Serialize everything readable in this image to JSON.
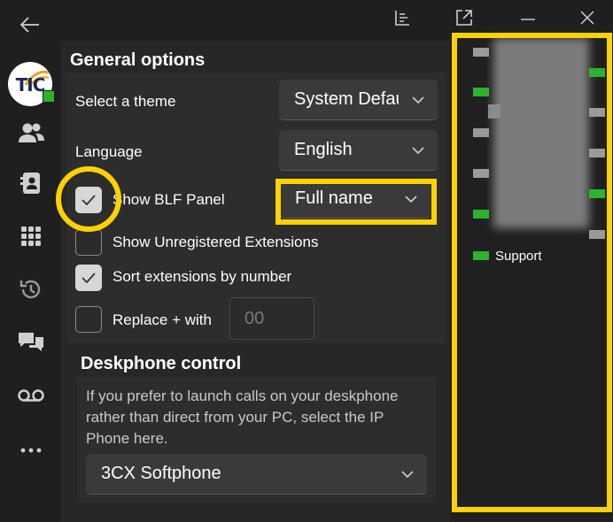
{
  "colors": {
    "accent_yellow": "#ffd200",
    "presence_green": "#2db22d",
    "status_grey": "#9a9a9a",
    "panel_bg": "#2d2d2d"
  },
  "avatar": {
    "text": "TIC"
  },
  "general": {
    "title": "General options",
    "theme": {
      "label": "Select a theme",
      "value": "System Default"
    },
    "language": {
      "label": "Language",
      "value": "English"
    },
    "show_blf": {
      "label": "Show BLF Panel",
      "checked": true,
      "mode": "Full name"
    },
    "unregistered": {
      "label": "Show Unregistered Extensions",
      "checked": false
    },
    "sort_by_number": {
      "label": "Sort extensions by number",
      "checked": true
    },
    "replace_plus": {
      "label": "Replace + with",
      "checked": false,
      "placeholder": "00"
    }
  },
  "deskphone": {
    "title": "Deskphone control",
    "description_line1": "If you prefer to launch calls on your deskphone",
    "description_line2": "rather than direct from your PC, select the IP",
    "description_line3": "Phone here.",
    "device": "3CX Softphone"
  },
  "blf_panel": {
    "visible_label": "Support"
  },
  "icons": {
    "back": "back-arrow-icon",
    "toolbar": [
      "chart-icon",
      "popout-icon",
      "minimize-icon",
      "close-icon"
    ],
    "rail": [
      "people-icon",
      "contacts-icon",
      "dialpad-icon",
      "history-icon",
      "chat-icon",
      "voicemail-icon",
      "more-icon"
    ]
  }
}
